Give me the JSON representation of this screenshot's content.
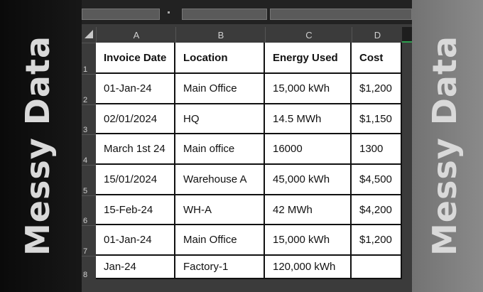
{
  "side_text": "Messy Data",
  "columns": [
    "A",
    "B",
    "C",
    "D"
  ],
  "rows": [
    "1",
    "2",
    "3",
    "4",
    "5",
    "6",
    "7",
    "8"
  ],
  "headers": [
    "Invoice Date",
    "Location",
    "Energy Used",
    "Cost"
  ],
  "data": [
    [
      "01-Jan-24",
      "Main Office",
      "15,000 kWh",
      "$1,200"
    ],
    [
      "02/01/2024",
      "HQ",
      "14.5 MWh",
      "$1,150"
    ],
    [
      "March 1st 24",
      "Main office",
      "16000",
      "1300"
    ],
    [
      "15/01/2024",
      "Warehouse A",
      "45,000 kWh",
      "$4,500"
    ],
    [
      "15-Feb-24",
      "WH-A",
      "42 MWh",
      "$4,200"
    ],
    [
      "01-Jan-24",
      "Main Office",
      "15,000 kWh",
      "$1,200"
    ],
    [
      "Jan-24",
      "Factory-1",
      "120,000 kWh",
      ""
    ]
  ],
  "colors": {
    "side_text": "#d9d9d9",
    "selection_green": "#2e9e4f",
    "grid_header_bg": "#3b3b3b"
  }
}
